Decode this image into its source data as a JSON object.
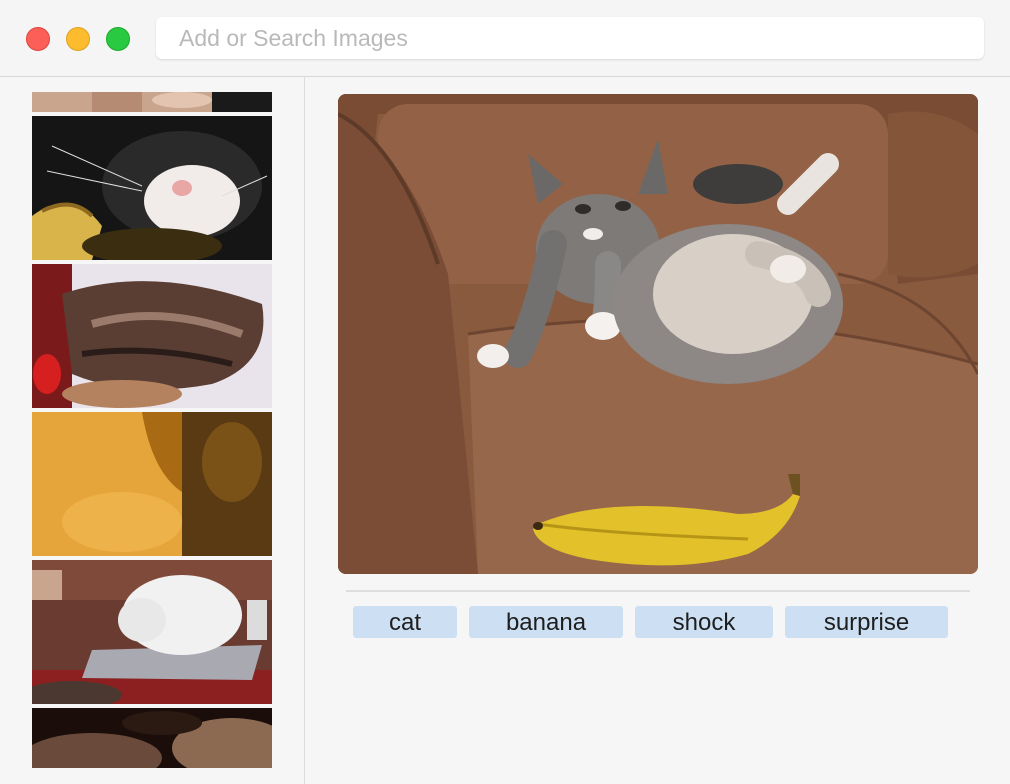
{
  "search": {
    "placeholder": "Add or Search Images",
    "value": ""
  },
  "window_controls": [
    "close",
    "minimize",
    "zoom"
  ],
  "sidebar": {
    "thumbnails": [
      {
        "name": "hand-petting"
      },
      {
        "name": "black-white-cat-sleeping"
      },
      {
        "name": "wet-animal"
      },
      {
        "name": "orange-blur"
      },
      {
        "name": "white-dog-on-foil"
      },
      {
        "name": "dark-animal"
      }
    ]
  },
  "preview": {
    "description_icon": "kittens-on-couch-with-banana"
  },
  "tags": [
    "cat",
    "banana",
    "shock",
    "surprise"
  ],
  "colors": {
    "tag_background": "#cde0f3",
    "close": "#fc5f57",
    "minimize": "#fdbc2e",
    "zoom": "#29c941"
  }
}
